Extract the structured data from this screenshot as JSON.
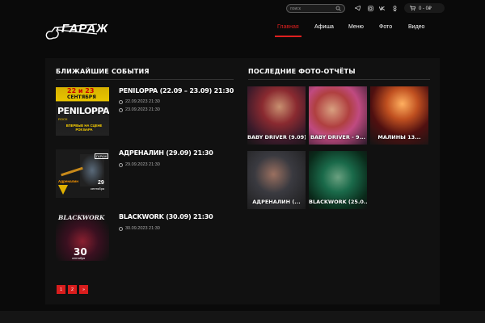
{
  "header": {
    "logo_text": "ГАРАЖ",
    "search_placeholder": "поиск",
    "cart_label": "0 - 0₽",
    "nav": [
      "Главная",
      "Афиша",
      "Меню",
      "Фото",
      "Видео"
    ]
  },
  "icons": {
    "social": [
      "telegram-icon",
      "instagram-icon",
      "vk-icon",
      "odnoklassniki-icon"
    ]
  },
  "events_section": {
    "title": "БЛИЖАЙШИЕ СОБЫТИЯ",
    "events": [
      {
        "title": "PENILOPPA (22.09 – 23.09) 21:30",
        "dates": [
          "22.09.2023 21:30",
          "23.09.2023 21:30"
        ],
        "poster": {
          "line1": "22 и 23",
          "line2": "СЕНТЯБРЯ",
          "name": "PENILOPPA",
          "tag": "ROCK",
          "tagline": "ВПЕРВЫЕ НА СЦЕНЕ РОК БАРА"
        }
      },
      {
        "title": "АДРЕНАЛИН (29.09) 21:30",
        "dates": [
          "29.09.2023 21:30"
        ],
        "poster": {
          "name": "Адреналин",
          "day": "29",
          "month": "сентября",
          "club": "ГАРАЖ"
        }
      },
      {
        "title": "BLACKWORK (30.09) 21:30",
        "dates": [
          "30.09.2023 21:30"
        ],
        "poster": {
          "name": "BLACKWORK",
          "day": "30",
          "month": "сентября"
        }
      }
    ]
  },
  "photos_section": {
    "title": "ПОСЛЕДНИЕ ФОТО-ОТЧЁТЫ",
    "photos": [
      {
        "label": "BABY DRIVER (9.09)"
      },
      {
        "label": "BABY DRIVER - 9..."
      },
      {
        "label": "МАЛИНЫ 13..."
      },
      {
        "label": "АДРЕНАЛИН (..."
      },
      {
        "label": "BLACKWORK (25.0..."
      }
    ]
  },
  "pagination": [
    "1",
    "2",
    "»"
  ]
}
